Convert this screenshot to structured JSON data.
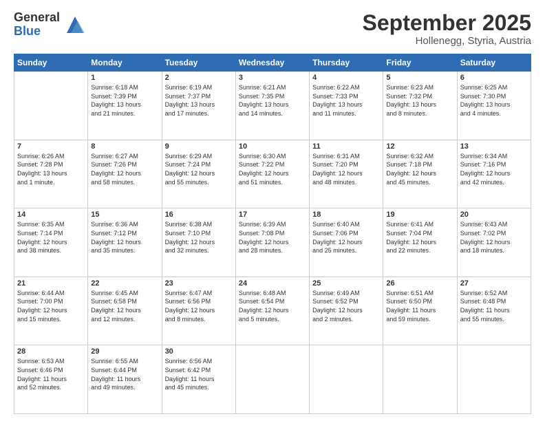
{
  "logo": {
    "general": "General",
    "blue": "Blue"
  },
  "header": {
    "month": "September 2025",
    "location": "Hollenegg, Styria, Austria"
  },
  "weekdays": [
    "Sunday",
    "Monday",
    "Tuesday",
    "Wednesday",
    "Thursday",
    "Friday",
    "Saturday"
  ],
  "weeks": [
    [
      {
        "day": "",
        "info": ""
      },
      {
        "day": "1",
        "info": "Sunrise: 6:18 AM\nSunset: 7:39 PM\nDaylight: 13 hours\nand 21 minutes."
      },
      {
        "day": "2",
        "info": "Sunrise: 6:19 AM\nSunset: 7:37 PM\nDaylight: 13 hours\nand 17 minutes."
      },
      {
        "day": "3",
        "info": "Sunrise: 6:21 AM\nSunset: 7:35 PM\nDaylight: 13 hours\nand 14 minutes."
      },
      {
        "day": "4",
        "info": "Sunrise: 6:22 AM\nSunset: 7:33 PM\nDaylight: 13 hours\nand 11 minutes."
      },
      {
        "day": "5",
        "info": "Sunrise: 6:23 AM\nSunset: 7:32 PM\nDaylight: 13 hours\nand 8 minutes."
      },
      {
        "day": "6",
        "info": "Sunrise: 6:25 AM\nSunset: 7:30 PM\nDaylight: 13 hours\nand 4 minutes."
      }
    ],
    [
      {
        "day": "7",
        "info": "Sunrise: 6:26 AM\nSunset: 7:28 PM\nDaylight: 13 hours\nand 1 minute."
      },
      {
        "day": "8",
        "info": "Sunrise: 6:27 AM\nSunset: 7:26 PM\nDaylight: 12 hours\nand 58 minutes."
      },
      {
        "day": "9",
        "info": "Sunrise: 6:29 AM\nSunset: 7:24 PM\nDaylight: 12 hours\nand 55 minutes."
      },
      {
        "day": "10",
        "info": "Sunrise: 6:30 AM\nSunset: 7:22 PM\nDaylight: 12 hours\nand 51 minutes."
      },
      {
        "day": "11",
        "info": "Sunrise: 6:31 AM\nSunset: 7:20 PM\nDaylight: 12 hours\nand 48 minutes."
      },
      {
        "day": "12",
        "info": "Sunrise: 6:32 AM\nSunset: 7:18 PM\nDaylight: 12 hours\nand 45 minutes."
      },
      {
        "day": "13",
        "info": "Sunrise: 6:34 AM\nSunset: 7:16 PM\nDaylight: 12 hours\nand 42 minutes."
      }
    ],
    [
      {
        "day": "14",
        "info": "Sunrise: 6:35 AM\nSunset: 7:14 PM\nDaylight: 12 hours\nand 38 minutes."
      },
      {
        "day": "15",
        "info": "Sunrise: 6:36 AM\nSunset: 7:12 PM\nDaylight: 12 hours\nand 35 minutes."
      },
      {
        "day": "16",
        "info": "Sunrise: 6:38 AM\nSunset: 7:10 PM\nDaylight: 12 hours\nand 32 minutes."
      },
      {
        "day": "17",
        "info": "Sunrise: 6:39 AM\nSunset: 7:08 PM\nDaylight: 12 hours\nand 28 minutes."
      },
      {
        "day": "18",
        "info": "Sunrise: 6:40 AM\nSunset: 7:06 PM\nDaylight: 12 hours\nand 25 minutes."
      },
      {
        "day": "19",
        "info": "Sunrise: 6:41 AM\nSunset: 7:04 PM\nDaylight: 12 hours\nand 22 minutes."
      },
      {
        "day": "20",
        "info": "Sunrise: 6:43 AM\nSunset: 7:02 PM\nDaylight: 12 hours\nand 18 minutes."
      }
    ],
    [
      {
        "day": "21",
        "info": "Sunrise: 6:44 AM\nSunset: 7:00 PM\nDaylight: 12 hours\nand 15 minutes."
      },
      {
        "day": "22",
        "info": "Sunrise: 6:45 AM\nSunset: 6:58 PM\nDaylight: 12 hours\nand 12 minutes."
      },
      {
        "day": "23",
        "info": "Sunrise: 6:47 AM\nSunset: 6:56 PM\nDaylight: 12 hours\nand 8 minutes."
      },
      {
        "day": "24",
        "info": "Sunrise: 6:48 AM\nSunset: 6:54 PM\nDaylight: 12 hours\nand 5 minutes."
      },
      {
        "day": "25",
        "info": "Sunrise: 6:49 AM\nSunset: 6:52 PM\nDaylight: 12 hours\nand 2 minutes."
      },
      {
        "day": "26",
        "info": "Sunrise: 6:51 AM\nSunset: 6:50 PM\nDaylight: 11 hours\nand 59 minutes."
      },
      {
        "day": "27",
        "info": "Sunrise: 6:52 AM\nSunset: 6:48 PM\nDaylight: 11 hours\nand 55 minutes."
      }
    ],
    [
      {
        "day": "28",
        "info": "Sunrise: 6:53 AM\nSunset: 6:46 PM\nDaylight: 11 hours\nand 52 minutes."
      },
      {
        "day": "29",
        "info": "Sunrise: 6:55 AM\nSunset: 6:44 PM\nDaylight: 11 hours\nand 49 minutes."
      },
      {
        "day": "30",
        "info": "Sunrise: 6:56 AM\nSunset: 6:42 PM\nDaylight: 11 hours\nand 45 minutes."
      },
      {
        "day": "",
        "info": ""
      },
      {
        "day": "",
        "info": ""
      },
      {
        "day": "",
        "info": ""
      },
      {
        "day": "",
        "info": ""
      }
    ]
  ]
}
